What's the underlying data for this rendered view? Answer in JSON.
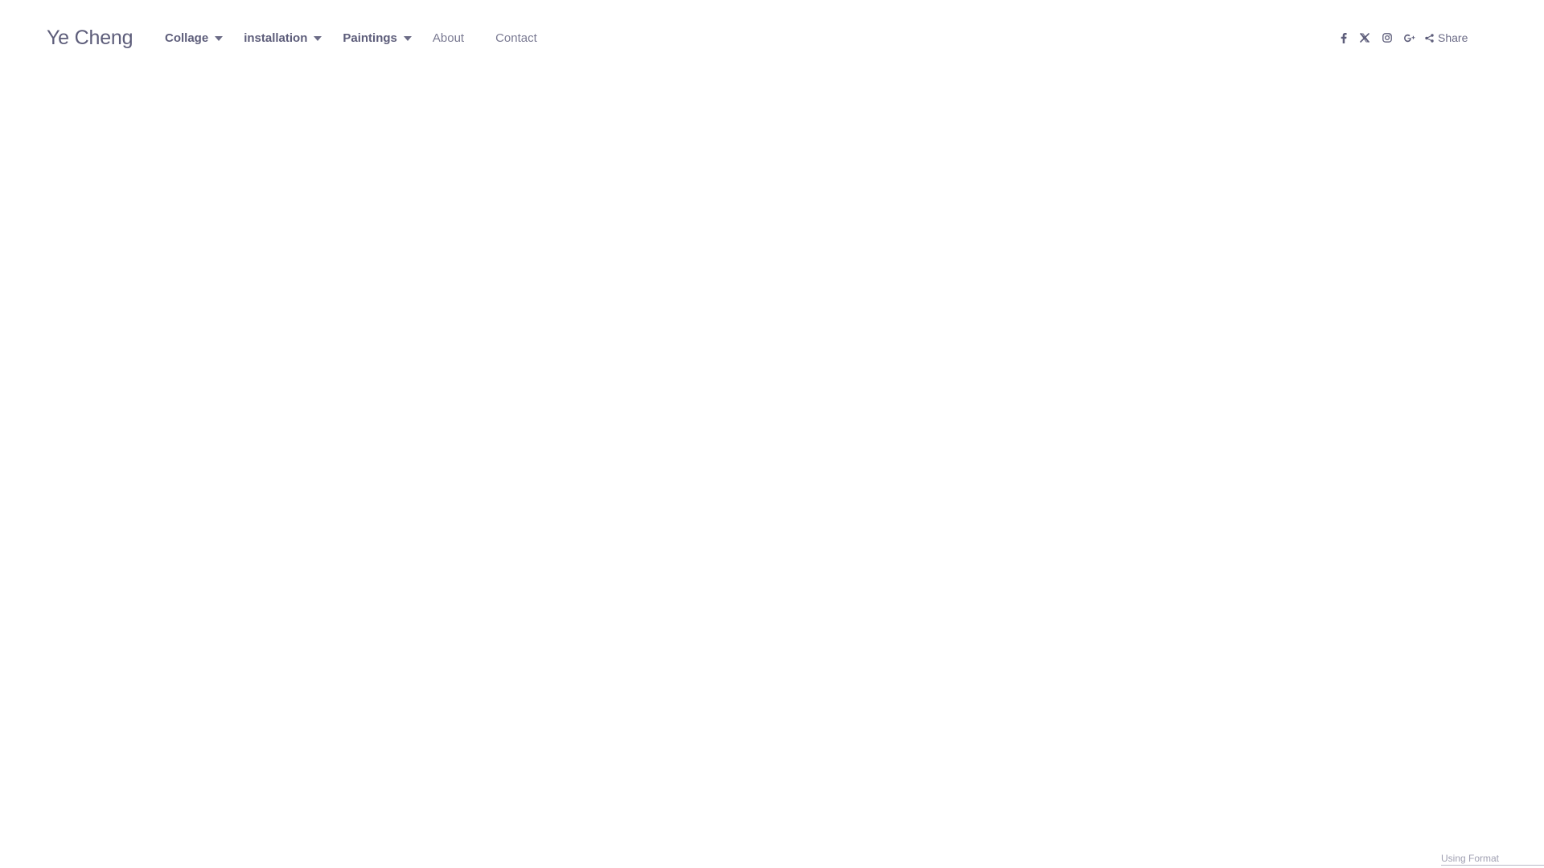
{
  "site": {
    "title": "Ye Cheng"
  },
  "nav": {
    "items": [
      {
        "label": "Collage",
        "has_dropdown": true
      },
      {
        "label": "installation",
        "has_dropdown": true
      },
      {
        "label": "Paintings",
        "has_dropdown": true
      },
      {
        "label": "About",
        "has_dropdown": false
      },
      {
        "label": "Contact",
        "has_dropdown": false
      }
    ]
  },
  "social": {
    "icons": [
      "facebook-icon",
      "x-twitter-icon",
      "instagram-icon",
      "google-plus-icon"
    ],
    "share_label": "Share"
  },
  "footer": {
    "credit": "Using Format"
  },
  "colors": {
    "text": "#5d5d7a",
    "muted": "#a0a0b2",
    "background": "#ffffff"
  }
}
